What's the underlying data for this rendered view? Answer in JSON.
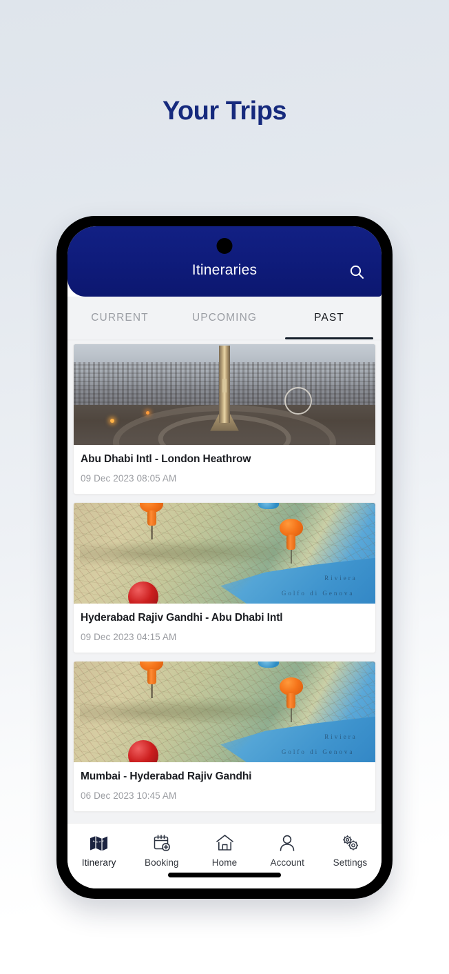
{
  "page": {
    "title": "Your Trips",
    "title_color": "#162a7d",
    "background_top": "#dfe5ec",
    "background_bottom": "#ffffff"
  },
  "app": {
    "header": {
      "title": "Itineraries",
      "background_color": "#0f1c7c",
      "search_icon": "search-icon"
    },
    "tabs": [
      {
        "label": "CURRENT",
        "active": false
      },
      {
        "label": "UPCOMING",
        "active": false
      },
      {
        "label": "PAST",
        "active": true
      }
    ],
    "trips": [
      {
        "title": "Abu Dhabi Intl - London Heathrow",
        "date": "09 Dec 2023 08:05 AM",
        "image": "city-monument-photo"
      },
      {
        "title": "Hyderabad Rajiv Gandhi - Abu Dhabi Intl",
        "date": "09 Dec 2023 04:15 AM",
        "image": "map-pushpins-photo"
      },
      {
        "title": "Mumbai - Hyderabad Rajiv Gandhi",
        "date": "06 Dec 2023 10:45 AM",
        "image": "map-pushpins-photo"
      }
    ],
    "map_labels": {
      "sea_name": "Golfo di Genova",
      "coast_name": "Riviera"
    },
    "bottom_nav": [
      {
        "label": "Itinerary",
        "icon": "map-icon",
        "active": true
      },
      {
        "label": "Booking",
        "icon": "calendar-add-icon",
        "active": false
      },
      {
        "label": "Home",
        "icon": "home-icon",
        "active": false
      },
      {
        "label": "Account",
        "icon": "person-icon",
        "active": false
      },
      {
        "label": "Settings",
        "icon": "gears-icon",
        "active": false
      }
    ]
  }
}
